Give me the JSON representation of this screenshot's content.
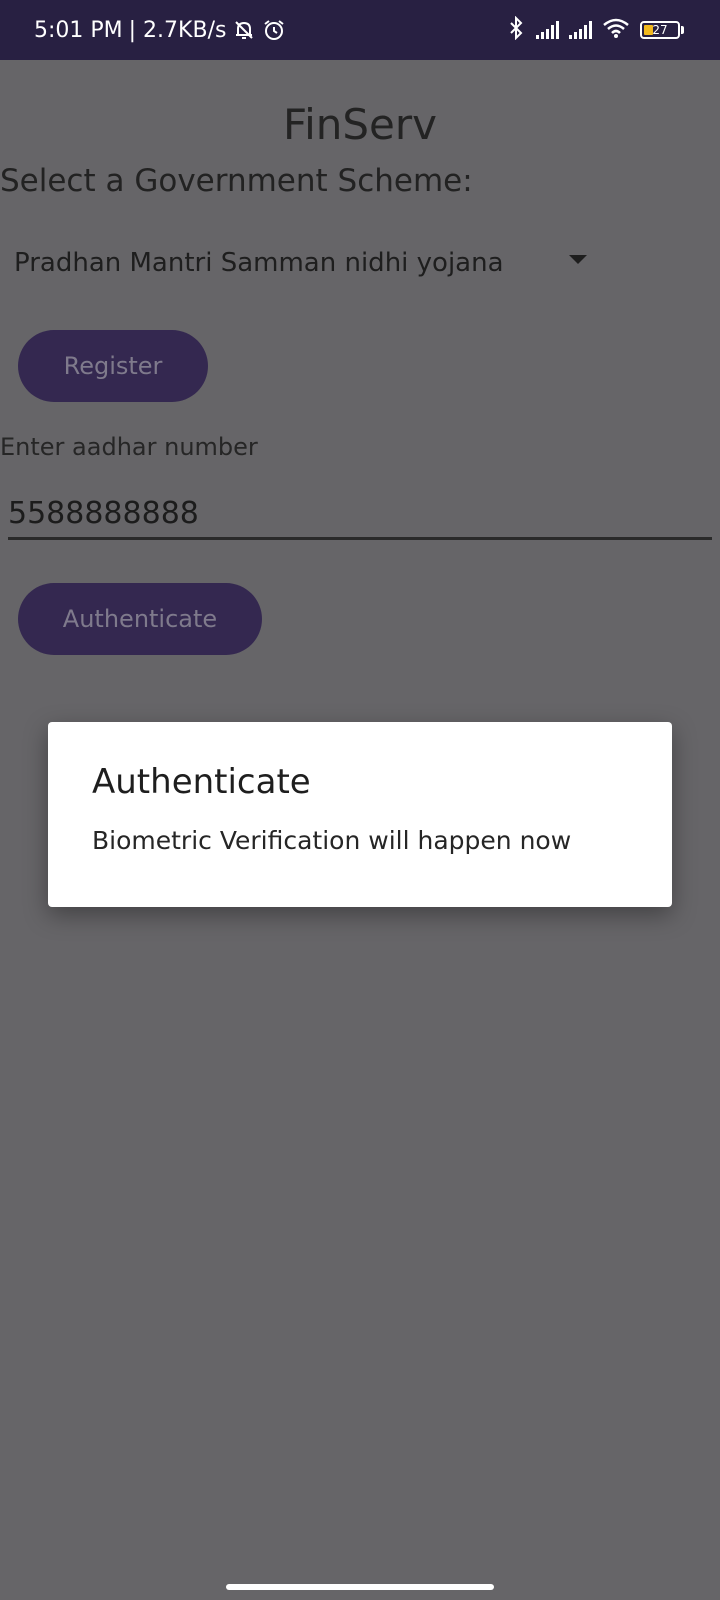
{
  "status_bar": {
    "time": "5:01 PM",
    "network_speed": "| 2.7KB/s",
    "icons": [
      "bell-muted-icon",
      "alarm-icon",
      "bluetooth-icon",
      "signal-icon",
      "signal-icon",
      "wifi-icon",
      "battery-icon"
    ],
    "battery_level": "27",
    "battery_fill_fraction": 0.27
  },
  "app": {
    "title": "FinServ",
    "scheme_label": "Select a Government Scheme:",
    "scheme_selected": "Pradhan Mantri Samman nidhi yojana",
    "register_label": "Register",
    "aadhar_label": "Enter aadhar number",
    "aadhar_value": "5588888888",
    "authenticate_label": "Authenticate"
  },
  "dialog": {
    "title": "Authenticate",
    "message": "Biometric Verification will happen now"
  },
  "colors": {
    "status_bar_bg": "#282042",
    "scrim_bg": "#666568",
    "button_bg": "#342850",
    "battery_accent": "#f2b91e"
  }
}
